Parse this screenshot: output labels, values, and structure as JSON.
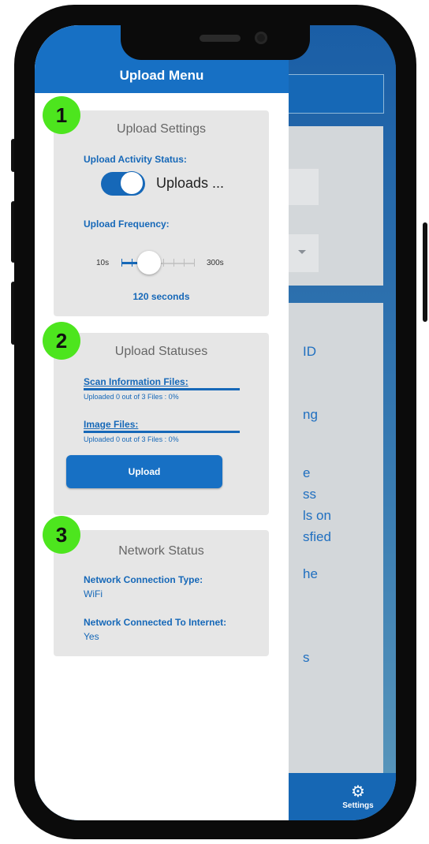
{
  "drawer": {
    "title": "Upload Menu"
  },
  "badges": [
    "1",
    "2",
    "3"
  ],
  "upload_settings": {
    "title": "Upload Settings",
    "activity_label": "Upload Activity Status:",
    "toggle_text": "Uploads ...",
    "toggle_on": true,
    "frequency_label": "Upload Frequency:",
    "slider_min": "10s",
    "slider_max": "300s",
    "slider_fraction": 0.38,
    "slider_value": "120 seconds"
  },
  "upload_statuses": {
    "title": "Upload Statuses",
    "scan_label": "Scan Information Files:",
    "scan_status": "Uploaded 0 out of 3 Files : 0%",
    "image_label": "Image Files:",
    "image_status": "Uploaded 0 out of 3 Files : 0%",
    "upload_button": "Upload"
  },
  "network_status": {
    "title": "Network Status",
    "type_label": "Network Connection Type:",
    "type_value": "WiFi",
    "internet_label": "Network Connected To Internet:",
    "internet_value": "Yes"
  },
  "background": {
    "text_fragments": [
      "ID",
      "ng",
      "e",
      "ss",
      "ls on",
      "sfied",
      "he",
      "s"
    ]
  },
  "tabbar": {
    "settings_label": "Settings",
    "settings_icon": "gears-icon"
  },
  "colors": {
    "accent": "#1770c4",
    "badge": "#4de51e",
    "card": "#e6e6e6"
  }
}
